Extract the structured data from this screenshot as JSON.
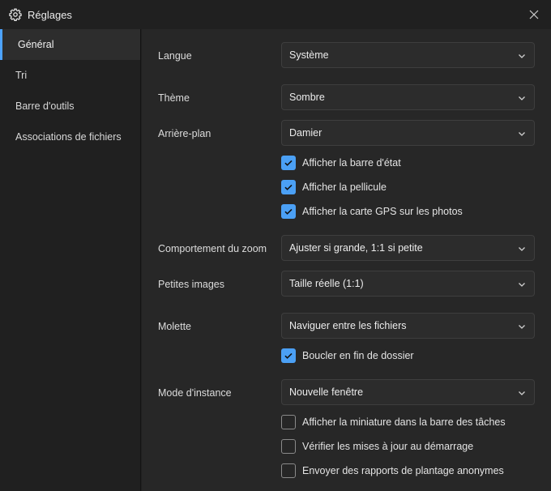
{
  "window": {
    "title": "Réglages",
    "icons": {
      "title": "gear-icon",
      "close": "close-icon"
    },
    "accent_color": "#4ba0f5"
  },
  "sidebar": {
    "items": [
      {
        "label": "Général",
        "active": true
      },
      {
        "label": "Tri",
        "active": false
      },
      {
        "label": "Barre d'outils",
        "active": false
      },
      {
        "label": "Associations de fichiers",
        "active": false
      }
    ]
  },
  "general": {
    "langue": {
      "label": "Langue",
      "value": "Système"
    },
    "theme": {
      "label": "Thème",
      "value": "Sombre"
    },
    "arriere_plan": {
      "label": "Arrière-plan",
      "value": "Damier"
    },
    "checks_display": [
      {
        "label": "Afficher la barre d'état",
        "checked": true
      },
      {
        "label": "Afficher la pellicule",
        "checked": true
      },
      {
        "label": "Afficher la carte GPS sur les photos",
        "checked": true
      }
    ],
    "zoom": {
      "label": "Comportement du zoom",
      "value": "Ajuster si grande, 1:1 si petite"
    },
    "petites_images": {
      "label": "Petites images",
      "value": "Taille réelle (1:1)"
    },
    "molette": {
      "label": "Molette",
      "value": "Naviguer entre les fichiers"
    },
    "check_loop": {
      "label": "Boucler en fin de dossier",
      "checked": true
    },
    "instance": {
      "label": "Mode d'instance",
      "value": "Nouvelle fenêtre"
    },
    "checks_misc": [
      {
        "label": "Afficher la miniature dans la barre des tâches",
        "checked": false
      },
      {
        "label": "Vérifier les mises à jour au démarrage",
        "checked": false
      },
      {
        "label": "Envoyer des rapports de plantage anonymes",
        "checked": false
      }
    ]
  }
}
